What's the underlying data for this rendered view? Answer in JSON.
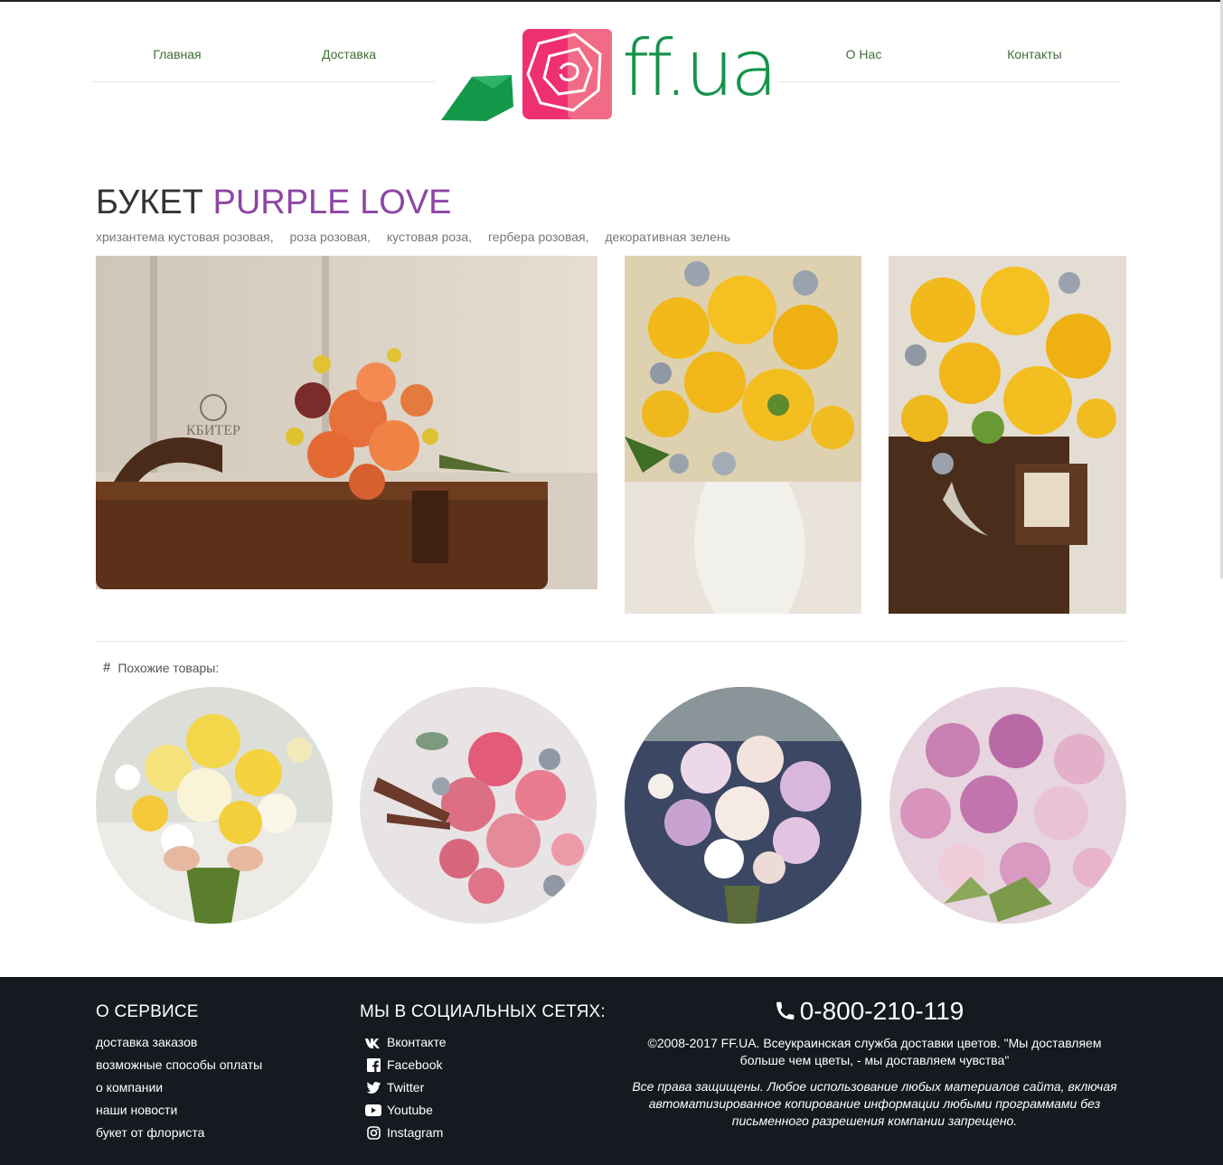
{
  "nav": {
    "left": [
      "Главная",
      "Доставка"
    ],
    "right": [
      "О Нас",
      "Контакты"
    ]
  },
  "logo": {
    "text": "ff.ua"
  },
  "product": {
    "title_prefix": "БУКЕТ",
    "title_name": "PURPLE LOVE",
    "tags": [
      "хризантема кустовая розовая,",
      "роза розовая,",
      "кустовая роза,",
      "гербера розовая,",
      "декоративная зелень"
    ]
  },
  "similar": {
    "label": "Похожие товары:"
  },
  "footer": {
    "service": {
      "heading": "О СЕРВИСЕ",
      "links": [
        "доставка заказов",
        "возможные способы оплаты",
        "о компании",
        "наши новости",
        "букет от флориста"
      ]
    },
    "social": {
      "heading": "МЫ В СОЦИАЛЬНЫХ СЕТЯХ:",
      "links": [
        {
          "label": "Вконтакте",
          "icon": "vk-icon"
        },
        {
          "label": "Facebook",
          "icon": "facebook-icon"
        },
        {
          "label": "Twitter",
          "icon": "twitter-icon"
        },
        {
          "label": "Youtube",
          "icon": "youtube-icon"
        },
        {
          "label": "Instagram",
          "icon": "instagram-icon"
        }
      ]
    },
    "phone": "0-800-210-119",
    "copyright": "©2008-2017 FF.UA. Всеукраинская служба доставки цветов. \"Мы доставляем больше чем цветы, - мы доставляем чувства\"",
    "rights": "Все права защищены. Любое использование любых материалов сайта, включая автоматизированное копирование информации любыми программами без письменного разрешения компании запрещено."
  },
  "colors": {
    "brand_green": "#15934a",
    "accent_purple": "#8e45a6",
    "nav_green": "#3f6e36",
    "footer_bg": "#141a1f"
  }
}
